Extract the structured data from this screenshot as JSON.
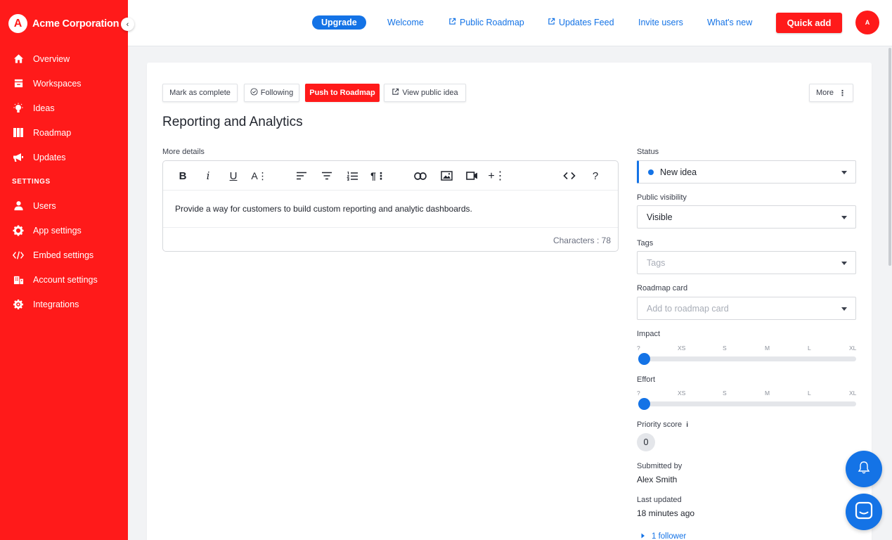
{
  "brand": {
    "logo_letter": "A",
    "name": "Acme Corporation"
  },
  "sidebar": {
    "items": [
      {
        "label": "Overview",
        "icon": "home-icon"
      },
      {
        "label": "Workspaces",
        "icon": "inbox-icon"
      },
      {
        "label": "Ideas",
        "icon": "lightbulb-icon"
      },
      {
        "label": "Roadmap",
        "icon": "roadmap-columns-icon"
      },
      {
        "label": "Updates",
        "icon": "megaphone-icon"
      }
    ],
    "settings_heading": "SETTINGS",
    "settings_items": [
      {
        "label": "Users",
        "icon": "user-icon"
      },
      {
        "label": "App settings",
        "icon": "gear-icon"
      },
      {
        "label": "Embed settings",
        "icon": "code-icon"
      },
      {
        "label": "Account settings",
        "icon": "building-icon"
      },
      {
        "label": "Integrations",
        "icon": "puzzle-icon"
      }
    ]
  },
  "topbar": {
    "upgrade": "Upgrade",
    "links": {
      "welcome": "Welcome",
      "public_roadmap": "Public Roadmap",
      "updates_feed": "Updates Feed",
      "invite_users": "Invite users",
      "whats_new": "What's new"
    },
    "quick_add": "Quick add",
    "avatar_initial": "A"
  },
  "actions": {
    "mark_complete": "Mark as complete",
    "following": "Following",
    "push_roadmap": "Push to Roadmap",
    "view_public": "View public idea",
    "more": "More"
  },
  "idea": {
    "title": "Reporting and Analytics",
    "details_label": "More details",
    "description": "Provide a way for customers to build custom reporting and analytic dashboards.",
    "char_count": "Characters : 78"
  },
  "sidepanel": {
    "status_label": "Status",
    "status_value": "New idea",
    "visibility_label": "Public visibility",
    "visibility_value": "Visible",
    "tags_label": "Tags",
    "tags_placeholder": "Tags",
    "roadmap_card_label": "Roadmap card",
    "roadmap_card_placeholder": "Add to roadmap card",
    "impact_label": "Impact",
    "impact_value": 0,
    "effort_label": "Effort",
    "effort_value": 0,
    "scale": [
      "?",
      "XS",
      "S",
      "M",
      "L",
      "XL"
    ],
    "priority_label": "Priority score",
    "priority_info": "i",
    "priority_value": "0",
    "submitted_label": "Submitted by",
    "submitted_value": "Alex Smith",
    "updated_label": "Last updated",
    "updated_value": "18 minutes ago",
    "followers": "1 follower"
  },
  "colors": {
    "brand_red": "#ff1a1a",
    "accent_blue": "#1473e6"
  }
}
